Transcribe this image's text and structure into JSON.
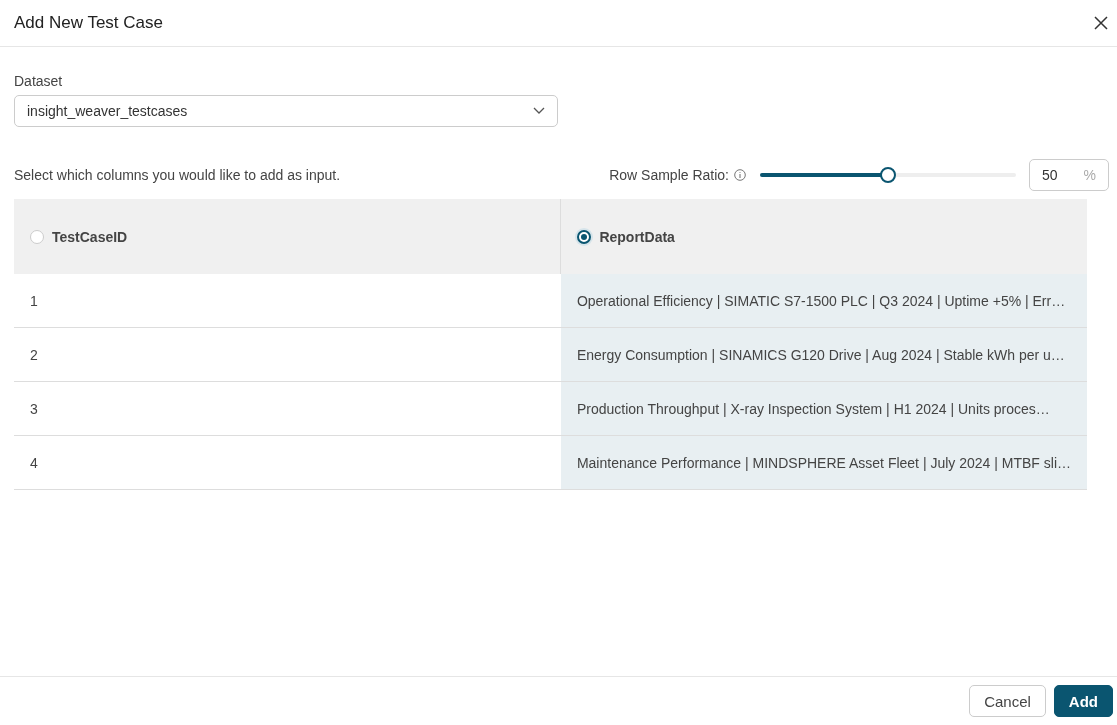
{
  "dialog": {
    "title": "Add New Test Case"
  },
  "dataset": {
    "label": "Dataset",
    "value": "insight_weaver_testcases"
  },
  "instruction": "Select which columns you would like to add as input.",
  "row_sample_ratio": {
    "label": "Row Sample Ratio:",
    "level": 0.5,
    "value": "50",
    "unit": "%"
  },
  "table": {
    "columns": [
      {
        "label": "TestCaseID",
        "selected": false
      },
      {
        "label": "ReportData",
        "selected": true
      }
    ],
    "rows": [
      [
        "1",
        "Operational Efficiency | SIMATIC S7-1500 PLC | Q3 2024 | Uptime +5% | Err…"
      ],
      [
        "2",
        "Energy Consumption | SINAMICS G120 Drive | Aug 2024 | Stable kWh per u…"
      ],
      [
        "3",
        "Production Throughput | X-ray Inspection System | H1 2024 | Units proces…"
      ],
      [
        "4",
        "Maintenance Performance | MINDSPHERE Asset Fleet | July 2024 | MTBF sli…"
      ]
    ]
  },
  "buttons": [
    {
      "label": "Cancel",
      "kind": "secondary"
    },
    {
      "label": "Add",
      "kind": "primary"
    }
  ]
}
